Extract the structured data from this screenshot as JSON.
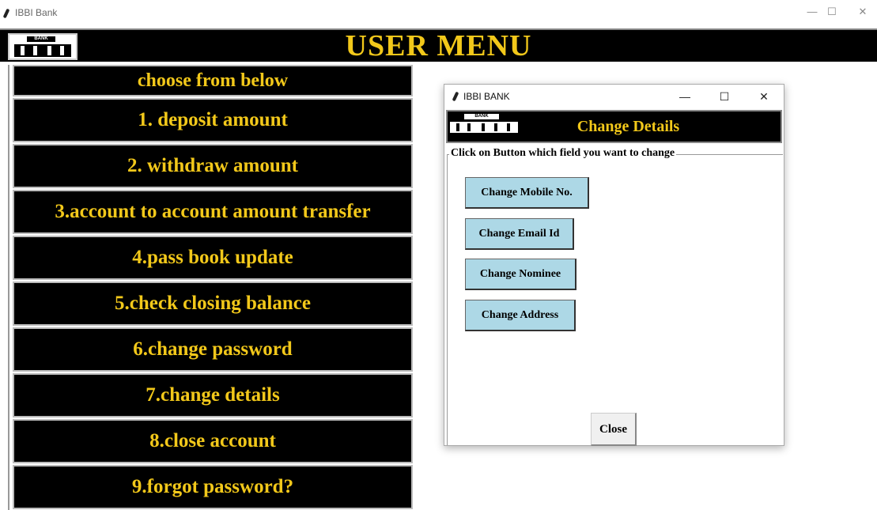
{
  "window": {
    "title": "IBBI Bank",
    "minimize": "—",
    "maximize": "☐",
    "close": "✕"
  },
  "header": {
    "title": "USER MENU",
    "logo_text": "BANK"
  },
  "menu": {
    "heading": "choose from below",
    "items": [
      {
        "label": "1. deposit amount"
      },
      {
        "label": "2. withdraw amount"
      },
      {
        "label": "3.account to account amount transfer"
      },
      {
        "label": "4.pass book update"
      },
      {
        "label": "5.check closing balance"
      },
      {
        "label": "6.change password"
      },
      {
        "label": "7.change details"
      },
      {
        "label": "8.close account"
      },
      {
        "label": "9.forgot password?"
      }
    ]
  },
  "dialog": {
    "title": "IBBI BANK",
    "minimize": "—",
    "maximize": "☐",
    "close": "✕",
    "logo_text": "BANK",
    "heading": "Change Details",
    "group_label": "Click on Button which field you want to change",
    "buttons": [
      {
        "label": "Change Mobile No."
      },
      {
        "label": "Change Email Id"
      },
      {
        "label": "Change Nominee"
      },
      {
        "label": "Change Address"
      }
    ],
    "close_label": "Close"
  },
  "colors": {
    "accent": "#f2c81a",
    "button_bg": "#add8e6",
    "menu_bg": "#000000"
  }
}
